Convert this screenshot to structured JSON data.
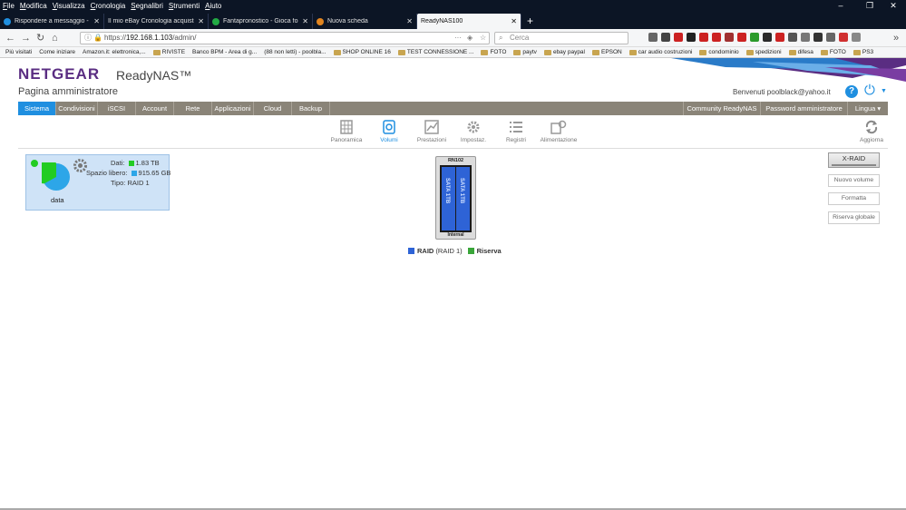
{
  "menubar": {
    "items": [
      "File",
      "Modifica",
      "Visualizza",
      "Cronologia",
      "Segnalibri",
      "Strumenti",
      "Aiuto"
    ]
  },
  "tabs": [
    {
      "title": "Rispondere a messaggio - NET",
      "color": "#1f8fe0"
    },
    {
      "title": "Il mio eBay Cronologia acquisti",
      "color": ""
    },
    {
      "title": "Fantapronostico - Gioca for fun",
      "color": "#22aa44"
    },
    {
      "title": "Nuova scheda",
      "color": "#e0841f"
    },
    {
      "title": "ReadyNAS100",
      "color": ""
    }
  ],
  "address": {
    "scheme": "https://",
    "host": "192.168.1.103",
    "path": "/admin/"
  },
  "search": {
    "placeholder": "Cerca"
  },
  "bookmarks": [
    "Più visitati",
    "Come iniziare",
    "Amazon.it: elettronica,...",
    "RIVISTE",
    "Banco BPM - Area di g...",
    "(88 non letti) - poolbla...",
    "SHOP ONLINE 16",
    "TEST CONNESSIONE ...",
    "FOTO",
    "paytv",
    "ebay paypal",
    "EPSON",
    "car audio costruzioni",
    "condominio",
    "spedizioni",
    "difesa",
    "FOTO",
    "PS3"
  ],
  "header": {
    "logo": "NETGEAR",
    "product": "ReadyNAS™",
    "subtitle": "Pagina amministratore",
    "welcome": "Benvenuti poolblack@yahoo.it",
    "help": "?"
  },
  "mainnav": {
    "left": [
      "Sistema",
      "Condivisioni",
      "iSCSI",
      "Account",
      "Rete",
      "Applicazioni",
      "Cloud",
      "Backup"
    ],
    "right": [
      "Community ReadyNAS",
      "Password amministratore",
      "Lingua ▾"
    ]
  },
  "subnav": [
    "Panoramica",
    "Volumi",
    "Prestazioni",
    "Impostaz.",
    "Registri",
    "Alimentazione"
  ],
  "refresh_label": "Aggiorna",
  "volume": {
    "name": "data",
    "data_label": "Dati:",
    "data_value": "1.83 TB",
    "free_label": "Spazio libero:",
    "free_value": "915.65 GB",
    "type_label": "Tipo:",
    "type_value": "RAID 1",
    "used_fraction": 0.67,
    "colors": {
      "used": "#22cc22",
      "free": "#2da6e8"
    }
  },
  "enclosure": {
    "model": "RN102",
    "bay_label": "Internal",
    "disk_labels": [
      "SATA 1TB",
      "SATA 1TB"
    ]
  },
  "legend": {
    "raid_label": "RAID",
    "raid_type": "(RAID 1)",
    "spare_label": "Riserva",
    "raid_color": "#2e63d6",
    "spare_color": "#3aa63a"
  },
  "actions": {
    "xraid": "X-RAID",
    "new_volume": "Nuovo volume",
    "format": "Formatta",
    "global_spare": "Riserva globale"
  }
}
